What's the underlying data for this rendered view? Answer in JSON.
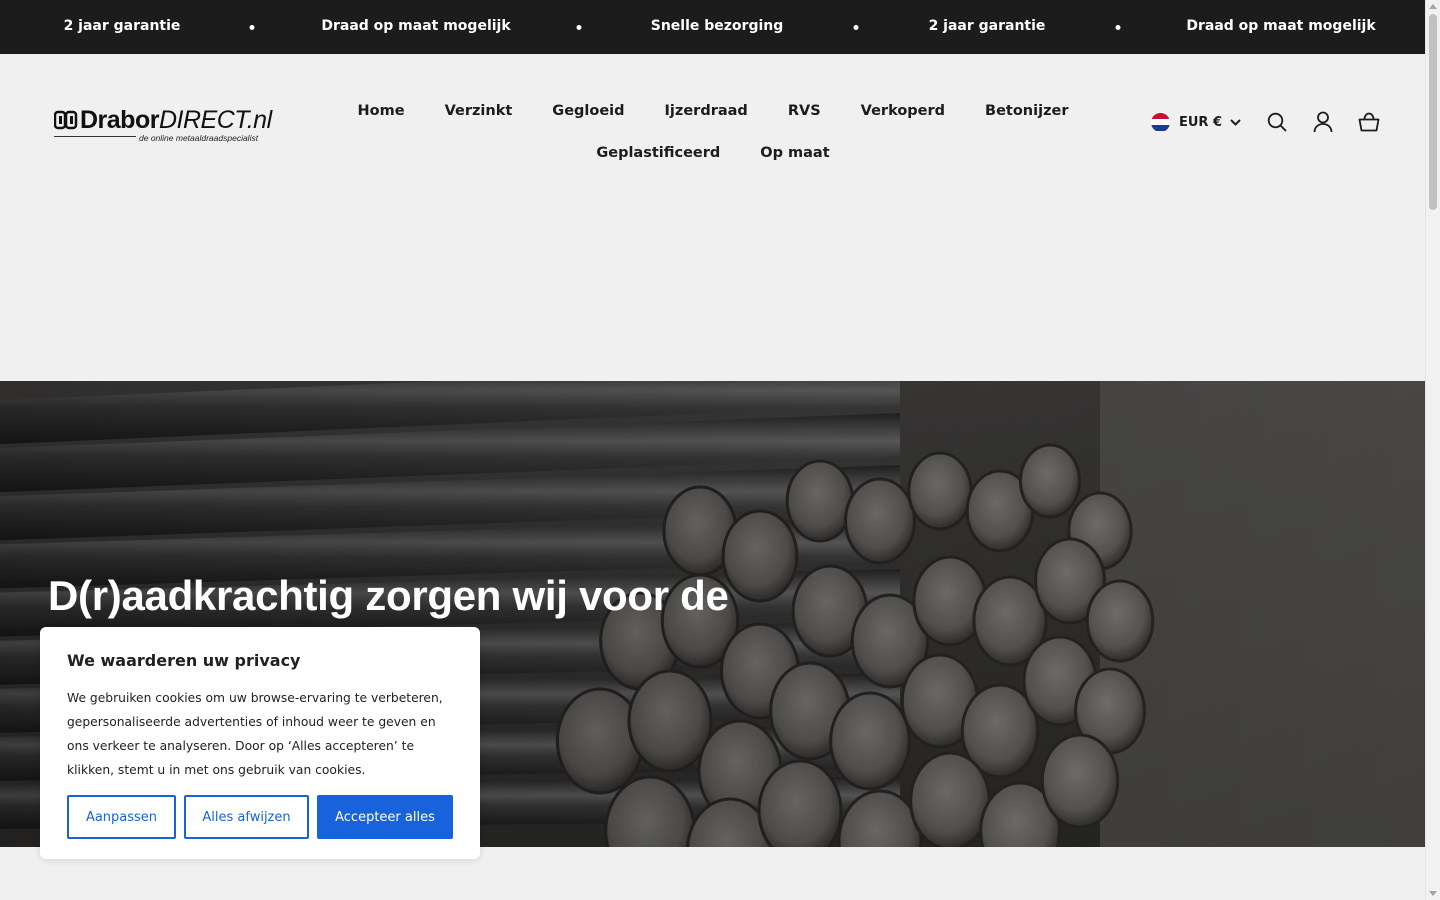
{
  "announcement": {
    "items": [
      "2 jaar garantie",
      "Draad op maat mogelijk",
      "Snelle bezorging",
      "2 jaar garantie",
      "Draad op maat mogelijk"
    ]
  },
  "header": {
    "logo": {
      "brand_bold": "Drabor",
      "brand_italic": "DIRECT.nl",
      "tagline": "de online metaaldraadspecialist"
    },
    "nav_row1": [
      "Home",
      "Verzinkt",
      "Gegloeid",
      "Ijzerdraad",
      "RVS",
      "Verkoperd",
      "Betonijzer"
    ],
    "nav_row2": [
      "Geplastificeerd",
      "Op maat"
    ],
    "currency": "EUR €"
  },
  "hero": {
    "title": "D(r)aadkrachtig zorgen wij voor de"
  },
  "cookie": {
    "title": "We waarderen uw privacy",
    "text": "We gebruiken cookies om uw browse-ervaring te verbeteren, gepersonaliseerde advertenties of inhoud weer te geven en ons verkeer te analyseren. Door op ‘Alles accepteren’ te klikken, stemt u in met ons gebruik van cookies.",
    "btn_customize": "Aanpassen",
    "btn_reject": "Alles afwijzen",
    "btn_accept": "Accepteer alles"
  },
  "colors": {
    "accent": "#1863dc",
    "announce_bg": "#1c1c1c",
    "page_bg": "#f0f0f0"
  },
  "icons": [
    "chevron-down-icon",
    "search-icon",
    "account-icon",
    "cart-icon",
    "scroll-arrow-up-icon",
    "scroll-arrow-down-icon"
  ]
}
